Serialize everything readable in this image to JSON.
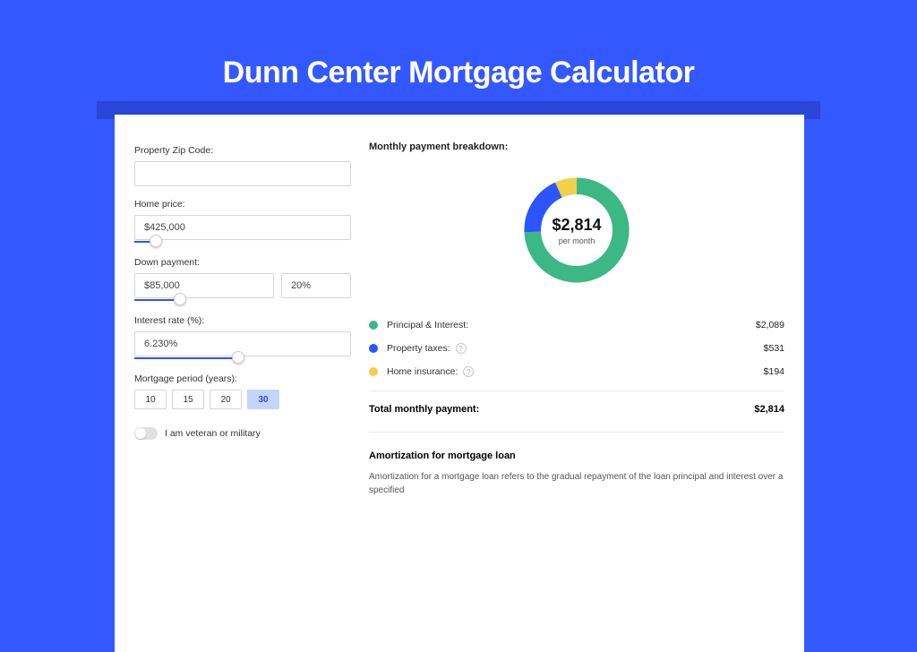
{
  "title": "Dunn Center Mortgage Calculator",
  "form": {
    "zip_label": "Property Zip Code:",
    "zip_value": "",
    "home_price_label": "Home price:",
    "home_price_value": "$425,000",
    "home_price_slider_pct": 10,
    "down_payment_label": "Down payment:",
    "down_payment_value": "$85,000",
    "down_payment_pct_value": "20%",
    "down_payment_slider_pct": 32,
    "interest_label": "Interest rate (%):",
    "interest_value": "6.230%",
    "interest_slider_pct": 48,
    "period_label": "Mortgage period (years):",
    "periods": [
      "10",
      "15",
      "20",
      "30"
    ],
    "period_active_index": 3,
    "veteran_label": "I am veteran or military"
  },
  "breakdown": {
    "title": "Monthly payment breakdown:",
    "center_amount": "$2,814",
    "center_sub": "per month",
    "items": [
      {
        "name": "Principal & Interest:",
        "amount": "$2,089",
        "color": "#3bb884",
        "info": false
      },
      {
        "name": "Property taxes:",
        "amount": "$531",
        "color": "#2b55ff",
        "info": true
      },
      {
        "name": "Home insurance:",
        "amount": "$194",
        "color": "#f3cf4a",
        "info": true
      }
    ],
    "total_label": "Total monthly payment:",
    "total_amount": "$2,814"
  },
  "amortization": {
    "title": "Amortization for mortgage loan",
    "text": "Amortization for a mortgage loan refers to the gradual repayment of the loan principal and interest over a specified"
  },
  "chart_data": {
    "type": "pie",
    "title": "Monthly payment breakdown",
    "series": [
      {
        "name": "Principal & Interest",
        "value": 2089,
        "color": "#3bb884"
      },
      {
        "name": "Property taxes",
        "value": 531,
        "color": "#2b55ff"
      },
      {
        "name": "Home insurance",
        "value": 194,
        "color": "#f3cf4a"
      }
    ],
    "total": 2814,
    "unit": "USD per month"
  }
}
